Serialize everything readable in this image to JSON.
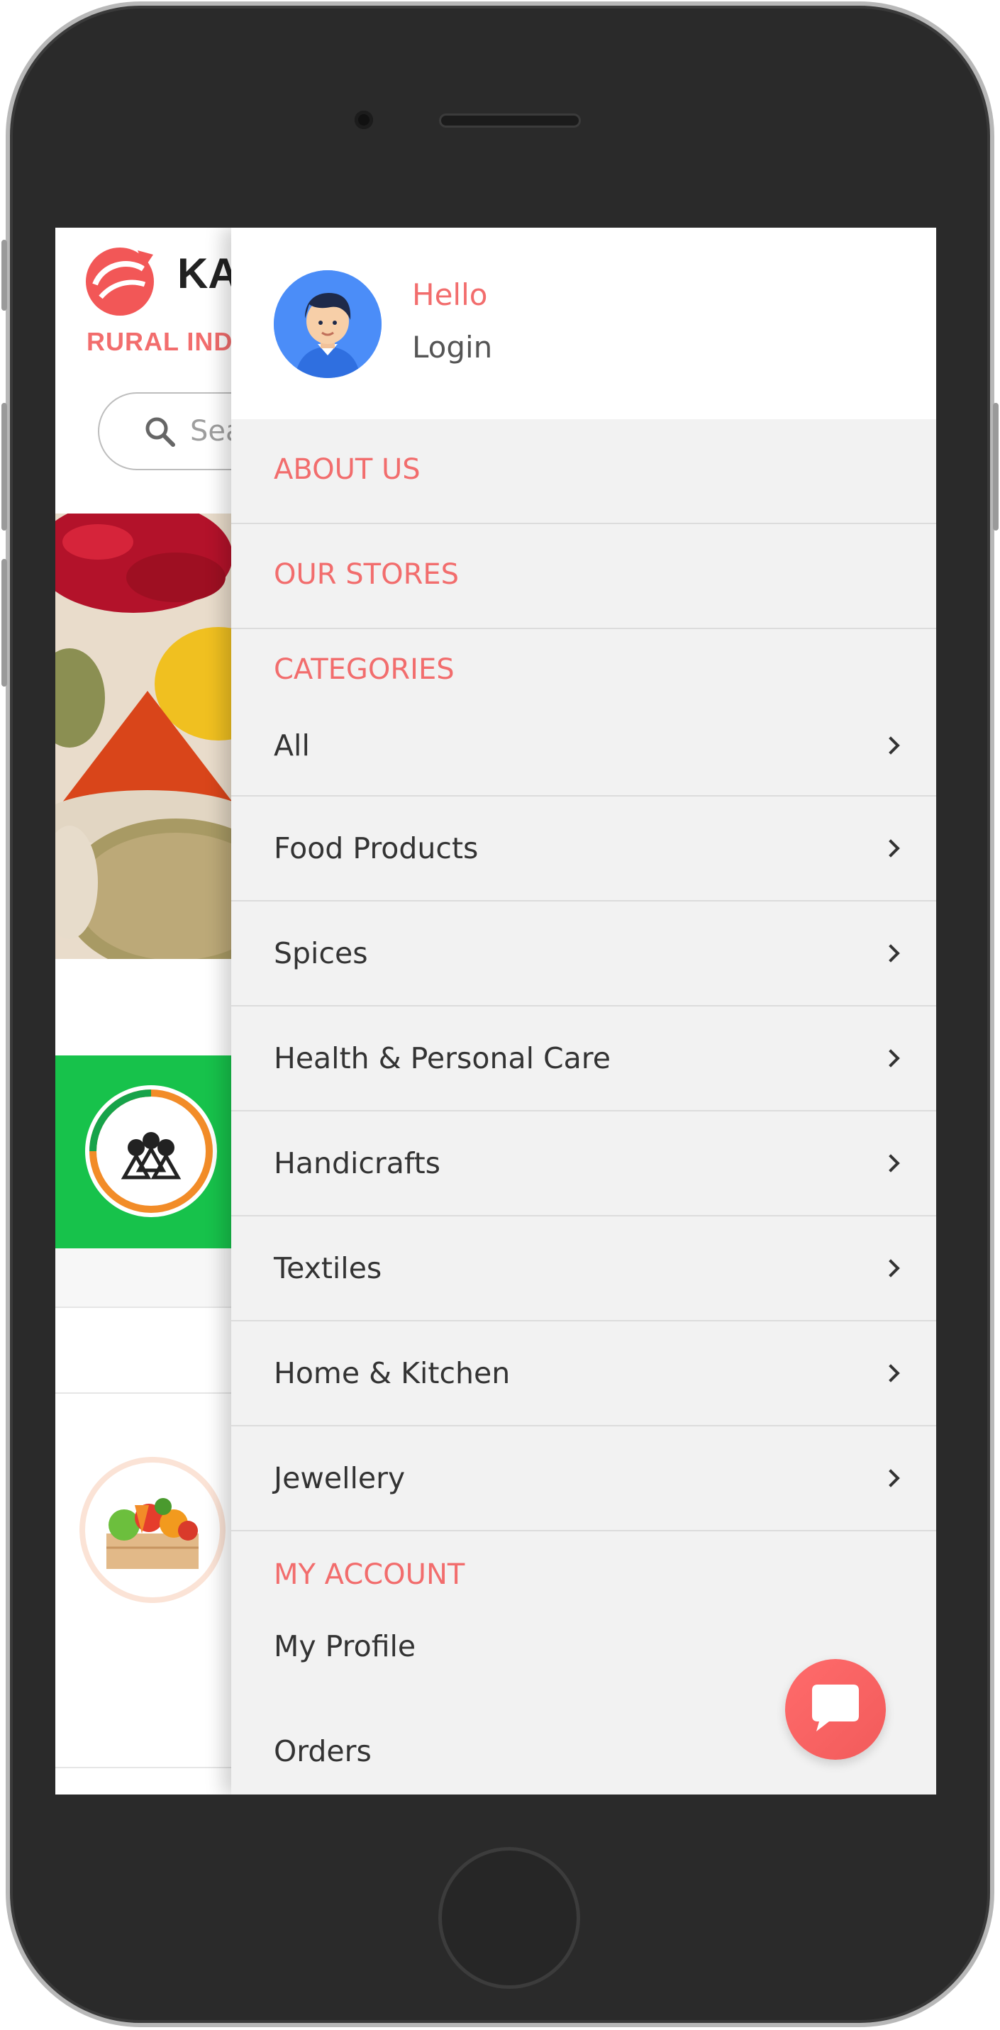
{
  "background_page": {
    "brand_visible": "KA",
    "tagline_visible": "RURAL IND",
    "search_placeholder_visible": "Sea"
  },
  "drawer": {
    "greeting": "Hello",
    "login_label": "Login",
    "about_us": "ABOUT US",
    "our_stores": "OUR STORES",
    "categories_title": "CATEGORIES",
    "categories": [
      {
        "label": "All"
      },
      {
        "label": "Food Products"
      },
      {
        "label": "Spices"
      },
      {
        "label": "Health & Personal Care"
      },
      {
        "label": "Handicrafts"
      },
      {
        "label": "Textiles"
      },
      {
        "label": "Home & Kitchen"
      },
      {
        "label": "Jewellery"
      }
    ],
    "my_account_title": "MY ACCOUNT",
    "account_items": [
      {
        "label": "My Profile"
      },
      {
        "label": "Orders"
      }
    ]
  },
  "colors": {
    "accent": "#f26d6d",
    "avatar_bg": "#4b8df8",
    "green_banner": "#17c24b",
    "drawer_bg": "#f2f2f2"
  },
  "icons": {
    "chat": "chat-bubble-icon",
    "chevron": "chevron-right-icon",
    "search": "search-icon"
  }
}
